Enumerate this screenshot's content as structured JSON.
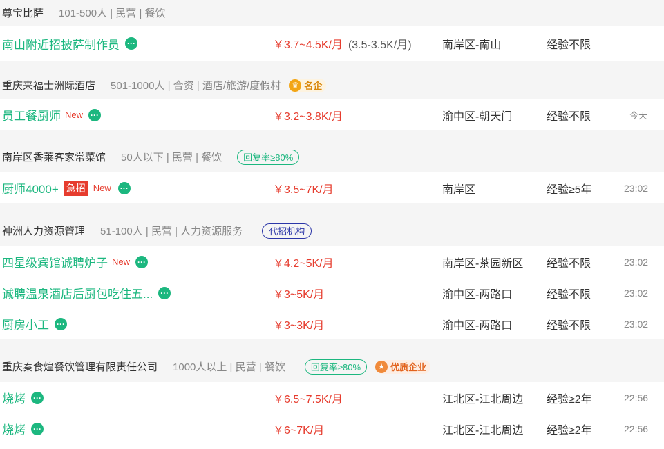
{
  "groups": [
    {
      "company": "尊宝比萨",
      "info": "101-500人 | 民营 | 餐饮",
      "jobs": [
        {
          "title": "南山附近招披萨制作员",
          "salary": "￥3.7~4.5K/月",
          "salary_extra": "(3.5-3.5K/月)",
          "area": "南岸区-南山",
          "experience": "经验不限",
          "time": ""
        }
      ]
    },
    {
      "company": "重庆来福士洲际酒店",
      "info": "501-1000人 | 合资 | 酒店/旅游/度假村",
      "badge": "名企",
      "jobs": [
        {
          "title": "员工餐厨师",
          "new": "New",
          "salary": "￥3.2~3.8K/月",
          "area": "渝中区-朝天门",
          "experience": "经验不限",
          "time": "今天"
        }
      ]
    },
    {
      "company": "南岸区香莱客家常菜馆",
      "info": "50人以下 | 民营 | 餐饮",
      "badge": "回复率≥80%",
      "jobs": [
        {
          "title": "厨师4000+",
          "urgent": "急招",
          "new": "New",
          "salary": "￥3.5~7K/月",
          "area": "南岸区",
          "experience": "经验≥5年",
          "time": "23:02"
        }
      ]
    },
    {
      "company": "神洲人力资源管理",
      "info": "51-100人 | 民营 | 人力资源服务",
      "badge": "代招机构",
      "jobs": [
        {
          "title": "四星级宾馆诚聘炉子",
          "new": "New",
          "salary": "￥4.2~5K/月",
          "area": "南岸区-茶园新区",
          "experience": "经验不限",
          "time": "23:02"
        },
        {
          "title": "诚聘温泉酒店后厨包吃住五...",
          "salary": "￥3~5K/月",
          "area": "渝中区-两路口",
          "experience": "经验不限",
          "time": "23:02"
        },
        {
          "title": "厨房小工",
          "salary": "￥3~3K/月",
          "area": "渝中区-两路口",
          "experience": "经验不限",
          "time": "23:02"
        }
      ]
    },
    {
      "company": "重庆秦食煌餐饮管理有限责任公司",
      "info": "1000人以上 | 民营 | 餐饮",
      "badge": "回复率≥80%",
      "badge2": "优质企业",
      "jobs": [
        {
          "title": "烧烤",
          "salary": "￥6.5~7.5K/月",
          "area": "江北区-江北周边",
          "experience": "经验≥2年",
          "time": "22:56"
        },
        {
          "title": "烧烤",
          "salary": "￥6~7K/月",
          "area": "江北区-江北周边",
          "experience": "经验≥2年",
          "time": "22:56"
        }
      ]
    }
  ]
}
